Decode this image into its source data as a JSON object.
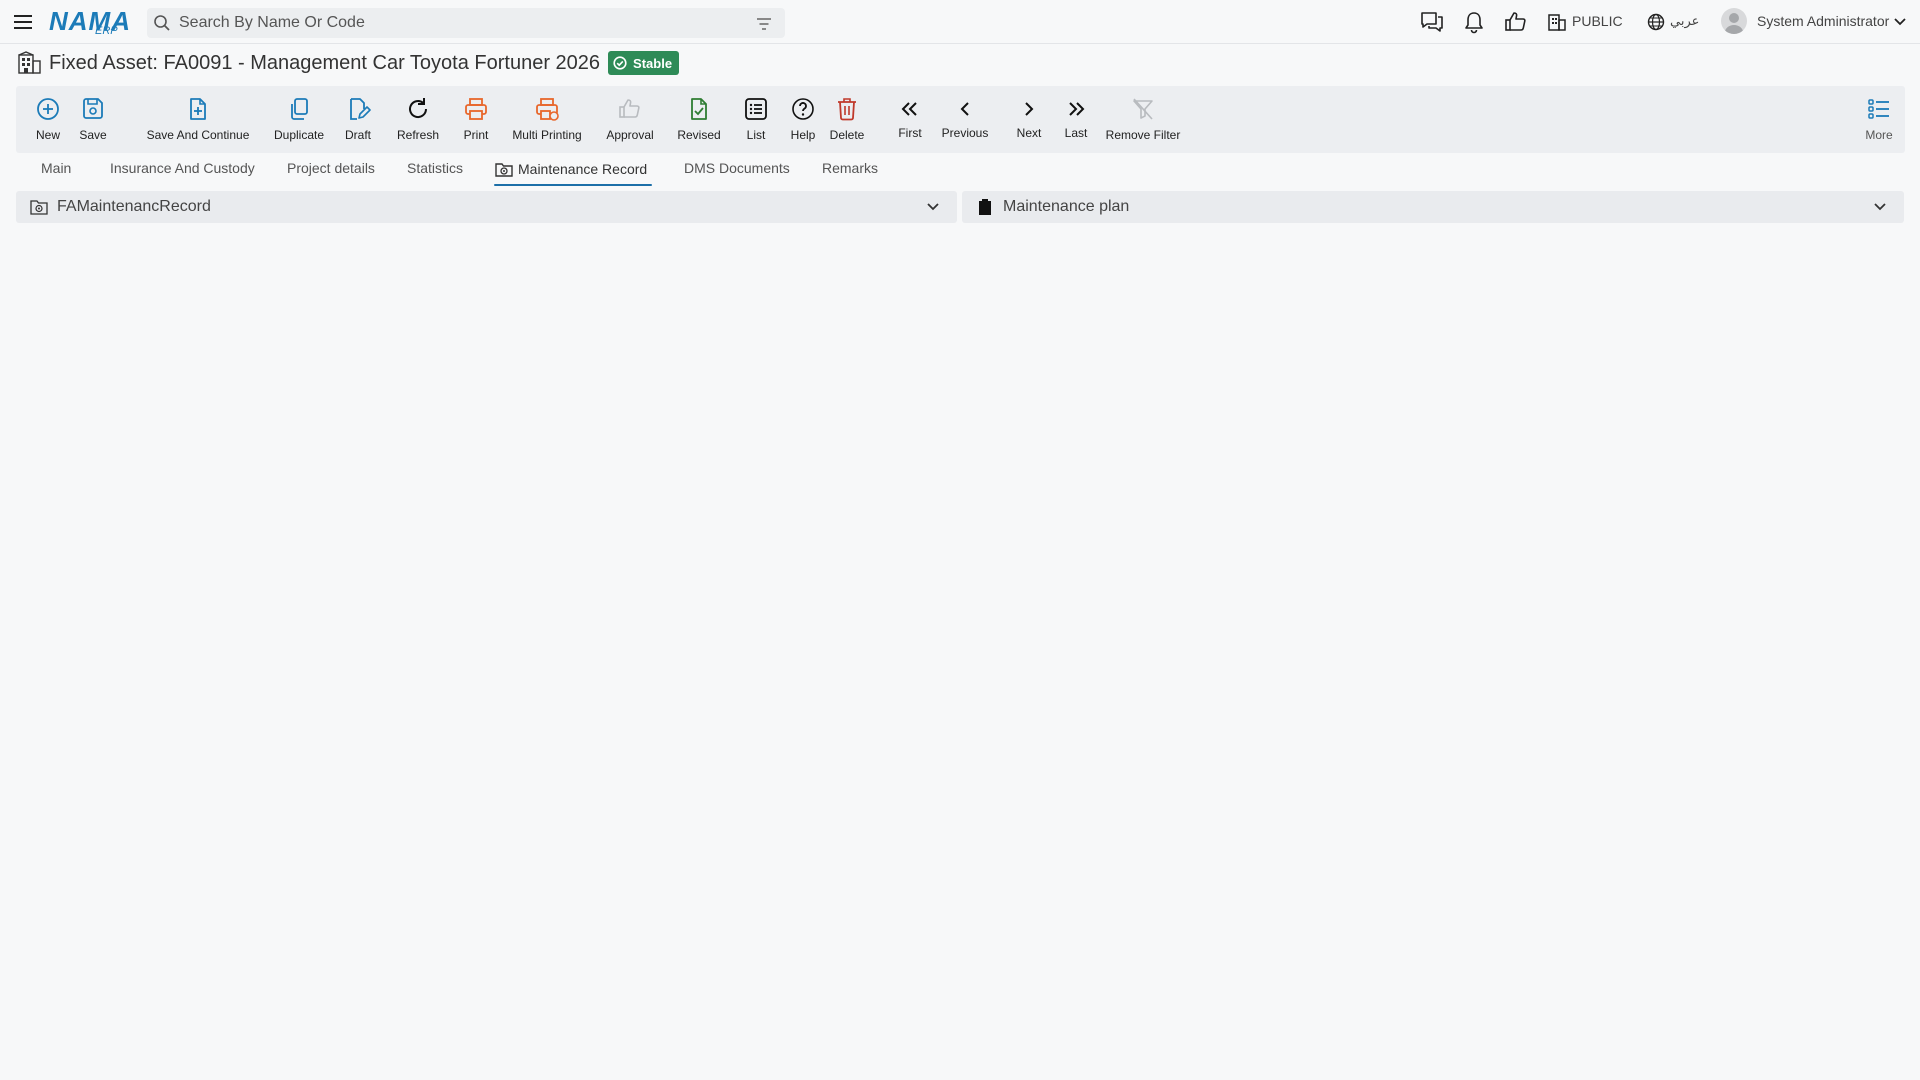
{
  "app": {
    "logo_text": "NAMA",
    "logo_sub": "ERP"
  },
  "search": {
    "placeholder": "Search By Name Or Code",
    "value": ""
  },
  "header": {
    "company": "PUBLIC",
    "language": "عربي",
    "user": "System Administrator"
  },
  "page": {
    "title": "Fixed Asset: FA0091 - Management Car Toyota Fortuner 2026",
    "status": "Stable"
  },
  "toolbar": {
    "new": "New",
    "save": "Save",
    "save_continue": "Save And Continue",
    "duplicate": "Duplicate",
    "draft": "Draft",
    "refresh": "Refresh",
    "print": "Print",
    "multi_printing": "Multi Printing",
    "approval": "Approval",
    "revised": "Revised",
    "list": "List",
    "help": "Help",
    "delete": "Delete",
    "first": "First",
    "previous": "Previous",
    "next": "Next",
    "last": "Last",
    "remove_filter": "Remove Filter",
    "more": "More"
  },
  "tabs": [
    {
      "label": "Main"
    },
    {
      "label": "Insurance And Custody"
    },
    {
      "label": "Project details"
    },
    {
      "label": "Statistics"
    },
    {
      "label": "Maintenance Record",
      "active": true
    },
    {
      "label": "DMS Documents"
    },
    {
      "label": "Remarks"
    }
  ],
  "panels": {
    "left": {
      "title": "FAMaintenancRecord"
    },
    "right": {
      "title": "Maintenance plan"
    }
  },
  "colors": {
    "accent": "#1c7bb8",
    "status_green": "#2e8b57",
    "print_orange": "#e8662b",
    "delete_red": "#c0392b",
    "revised_green": "#2e7d32"
  }
}
